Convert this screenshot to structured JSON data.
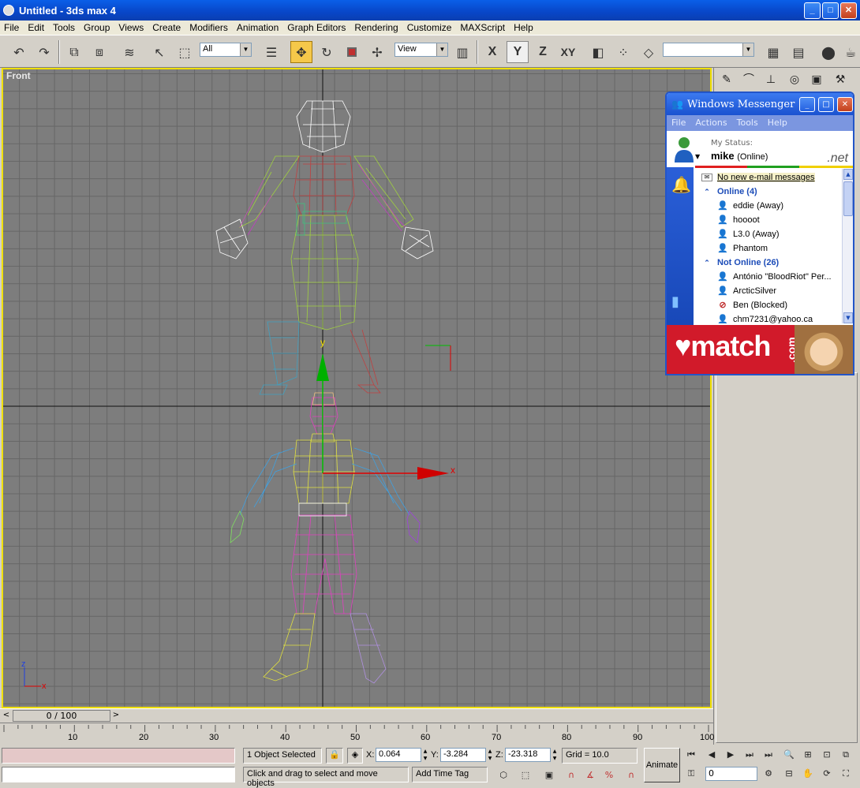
{
  "window": {
    "title": "Untitled - 3ds max 4",
    "min": "_",
    "max": "□",
    "close": "✕"
  },
  "menu": [
    "File",
    "Edit",
    "Tools",
    "Group",
    "Views",
    "Create",
    "Modifiers",
    "Animation",
    "Graph Editors",
    "Rendering",
    "Customize",
    "MAXScript",
    "Help"
  ],
  "toolbar": {
    "selection_filter": "All",
    "ref_coord": "View",
    "named_selection": "",
    "axis_x": "X",
    "axis_y": "Y",
    "axis_z": "Z",
    "axis_xy": "XY",
    "icons": [
      "undo-icon",
      "redo-icon",
      "select-and-link-icon",
      "unlink-icon",
      "bind-space-warp-icon",
      "select-object-icon",
      "rect-region-icon",
      "select-by-name-icon",
      "move-icon",
      "rotate-icon",
      "scale-icon",
      "manipulate-icon",
      "mirror-icon",
      "array-icon",
      "align-icon",
      "named-selection-icon",
      "layer-icon",
      "material-editor-icon"
    ]
  },
  "viewport": {
    "label": "Front",
    "axis_y": "y",
    "axis_x": "x",
    "axis_z": "z",
    "tripod_x": "x"
  },
  "messenger": {
    "title": "Windows Messenger",
    "menu": [
      "File",
      "Actions",
      "Tools",
      "Help"
    ],
    "my_status_label": "My Status:",
    "user": "mike",
    "status": "(Online)",
    "brand": ".net",
    "email": "No new e-mail messages",
    "groups": [
      {
        "label": "Online (4)",
        "contacts": [
          {
            "name": "eddie (Away)",
            "state": "away"
          },
          {
            "name": "hoooot",
            "state": "online"
          },
          {
            "name": "L3.0 (Away)",
            "state": "away"
          },
          {
            "name": "Phantom",
            "state": "online"
          }
        ]
      },
      {
        "label": "Not Online (26)",
        "contacts": [
          {
            "name": "António \"BloodRiot\" Per...",
            "state": "offline"
          },
          {
            "name": "ArcticSilver",
            "state": "offline"
          },
          {
            "name": "Ben (Blocked)",
            "state": "blocked"
          },
          {
            "name": "chm7231@yahoo.ca",
            "state": "offline"
          }
        ]
      }
    ],
    "ad": {
      "text": "match",
      "suffix": ".com"
    }
  },
  "timeline": {
    "slider": "0 / 100",
    "ticks": [
      "10",
      "20",
      "30",
      "40",
      "50",
      "60",
      "70",
      "80",
      "90",
      "100"
    ]
  },
  "status": {
    "selection": "1 Object Selected",
    "prompt": "Click and drag to select and move objects",
    "add_time_tag": "Add Time Tag",
    "x_label": "X:",
    "x": "0.064",
    "y_label": "Y:",
    "y": "-3.284",
    "z_label": "Z:",
    "z": "-23.318",
    "grid": "Grid = 10.0",
    "animate": "Animate",
    "frame": "0"
  },
  "colors": {
    "viewport_bg": "#7d7d7d",
    "active_border": "#f0e000",
    "title_blue": "#0846c8",
    "messenger_blue": "#2355c8",
    "ad_red": "#d11a2a"
  }
}
